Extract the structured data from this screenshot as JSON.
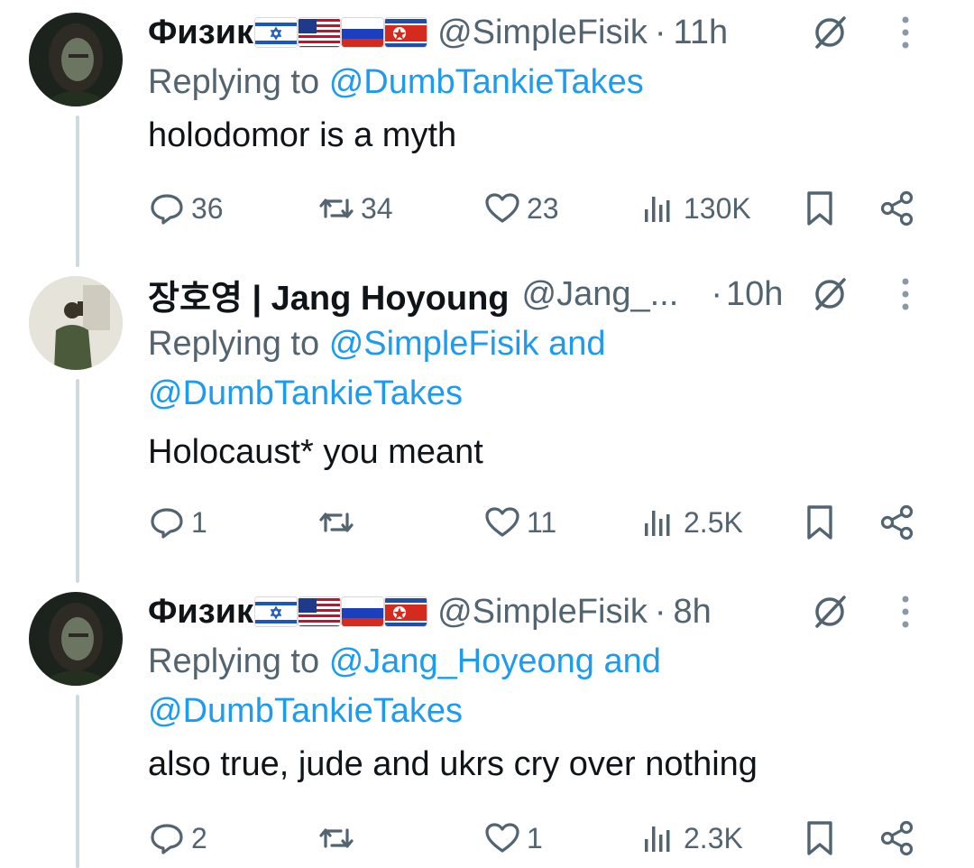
{
  "colors": {
    "text": "#0f1419",
    "secondary": "#536471",
    "link": "#1d9bf0",
    "thread_line": "#cfd9de"
  },
  "replying_label": "Replying to",
  "and_label": "and",
  "tweets": [
    {
      "name": "Физик",
      "flags": [
        "israel-flag",
        "usa-flag",
        "russia-flag",
        "north-korea-flag"
      ],
      "handle": "@SimpleFisik",
      "separator": "·",
      "time": "11h",
      "replying_to": [
        "@DumbTankieTakes"
      ],
      "text": "holodomor is a myth",
      "replies": "36",
      "reposts": "34",
      "likes": "23",
      "views": "130K"
    },
    {
      "name": "장호영 | Jang Hoyoung",
      "flags": [],
      "handle": "@Jang_...",
      "separator": "·",
      "time": "10h",
      "replying_to": [
        "@SimpleFisik",
        "@DumbTankieTakes"
      ],
      "text": "Holocaust* you meant",
      "replies": "1",
      "reposts": "",
      "likes": "11",
      "views": "2.5K"
    },
    {
      "name": "Физик",
      "flags": [
        "israel-flag",
        "usa-flag",
        "russia-flag",
        "north-korea-flag"
      ],
      "handle": "@SimpleFisik",
      "separator": "·",
      "time": "8h",
      "replying_to": [
        "@Jang_Hoyeong",
        "@DumbTankieTakes"
      ],
      "text": "also true, jude and ukrs cry over nothing",
      "replies": "2",
      "reposts": "",
      "likes": "1",
      "views": "2.3K"
    }
  ]
}
